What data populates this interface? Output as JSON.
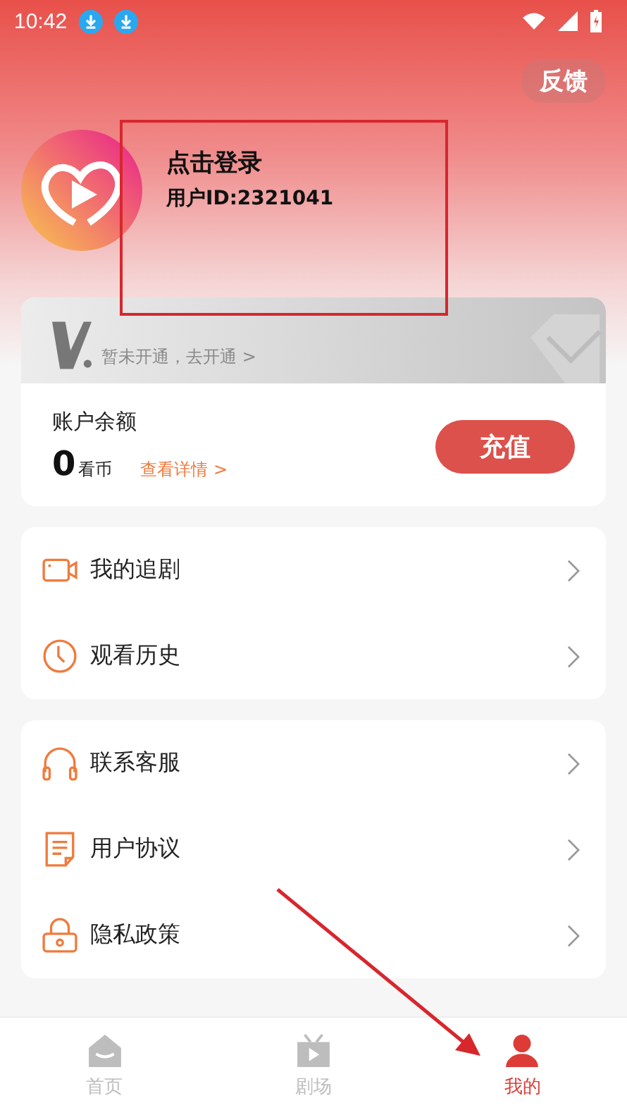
{
  "status_bar": {
    "time": "10:42",
    "notifications": [
      {
        "kind": "download"
      },
      {
        "kind": "download"
      }
    ]
  },
  "feedback_button": "反馈",
  "profile": {
    "name": "点击登录",
    "user_id": "用户ID:2321041"
  },
  "vip_banner": {
    "text": "暂未开通，去开通 >"
  },
  "balance": {
    "title": "账户余额",
    "amount": "0",
    "unit": "看币",
    "details_link": "查看详情 >",
    "recharge_button": "充值"
  },
  "menu_groups": [
    [
      {
        "kind": "video",
        "label": "我的追剧"
      },
      {
        "kind": "clock",
        "label": "观看历史"
      }
    ],
    [
      {
        "kind": "headset",
        "label": "联系客服"
      },
      {
        "kind": "document",
        "label": "用户协议"
      },
      {
        "kind": "lock",
        "label": "隐私政策"
      }
    ]
  ],
  "tabs": [
    {
      "kind": "home",
      "label": "首页",
      "selected": false
    },
    {
      "kind": "tv",
      "label": "剧场",
      "selected": false
    },
    {
      "kind": "person",
      "label": "我的",
      "selected": true
    }
  ]
}
